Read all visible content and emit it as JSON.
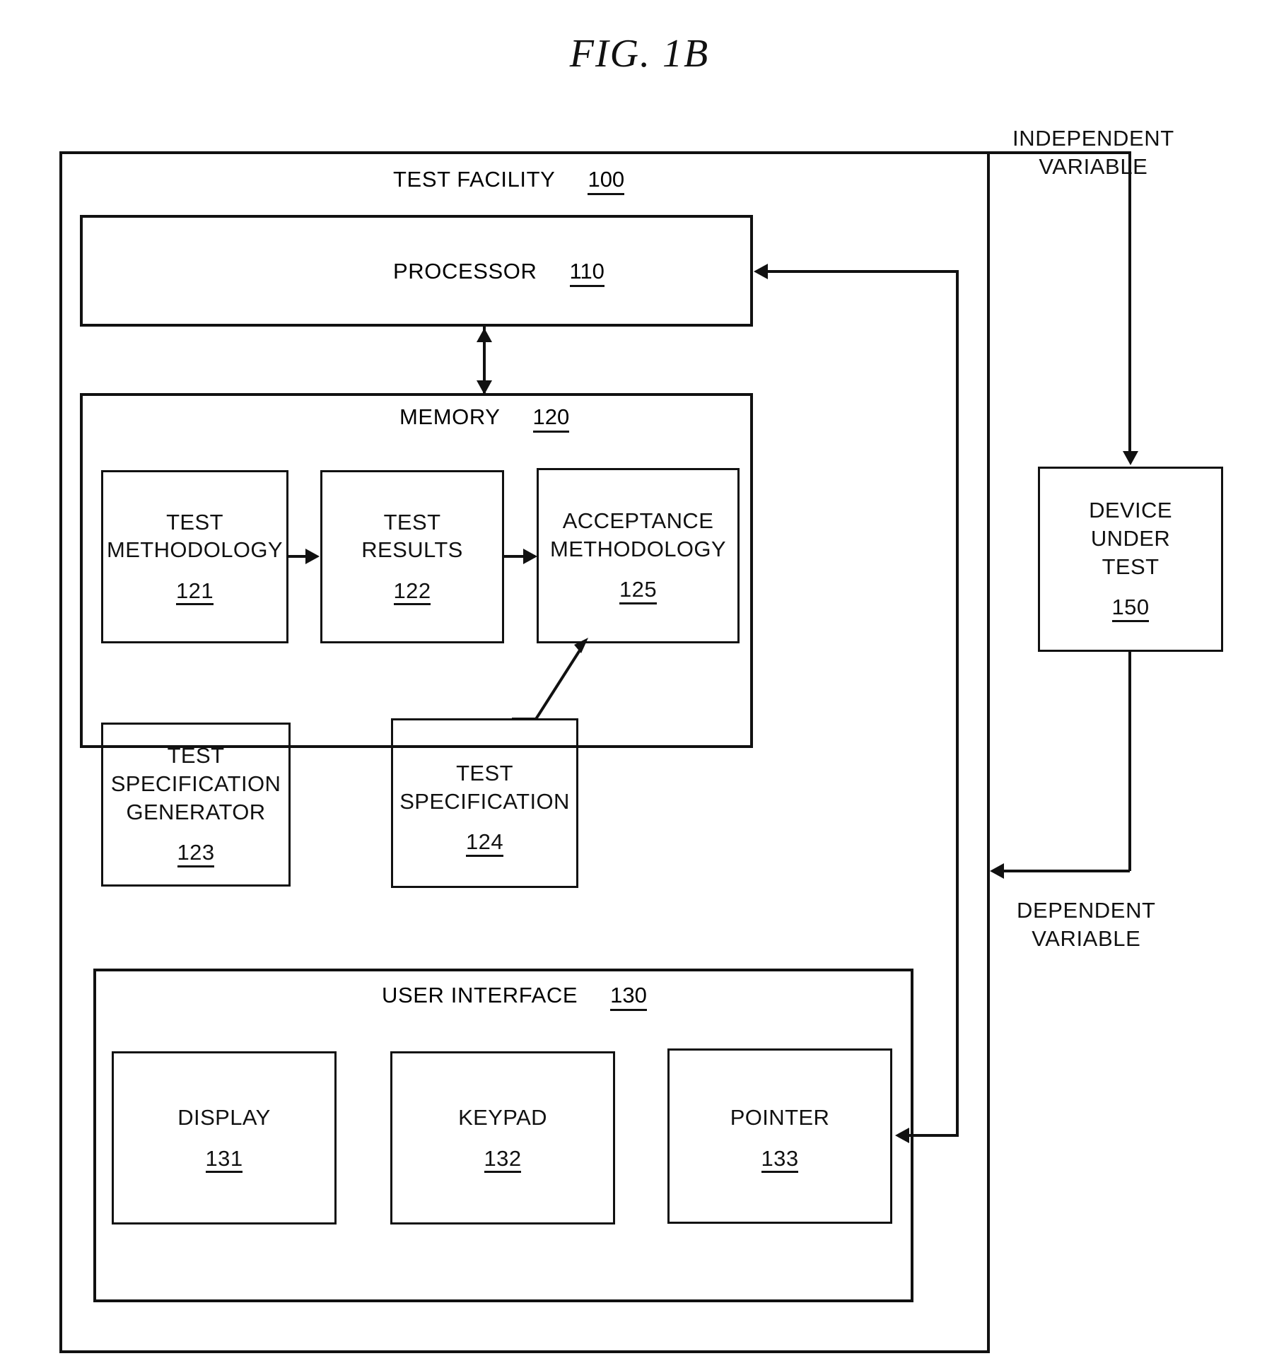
{
  "figure": {
    "title": "FIG. 1B"
  },
  "test_facility": {
    "label": "TEST FACILITY",
    "ref": "100"
  },
  "processor": {
    "label": "PROCESSOR",
    "ref": "110"
  },
  "memory": {
    "label": "MEMORY",
    "ref": "120",
    "blocks": [
      {
        "name": "test-methodology",
        "line1": "TEST",
        "line2": "METHODOLOGY",
        "line3": "",
        "ref": "121"
      },
      {
        "name": "test-results",
        "line1": "TEST",
        "line2": "RESULTS",
        "line3": "",
        "ref": "122"
      },
      {
        "name": "acceptance-methodology",
        "line1": "ACCEPTANCE",
        "line2": "METHODOLOGY",
        "line3": "",
        "ref": "125"
      },
      {
        "name": "test-specification-generator",
        "line1": "TEST",
        "line2": "SPECIFICATION",
        "line3": "GENERATOR",
        "ref": "123"
      },
      {
        "name": "test-specification",
        "line1": "TEST",
        "line2": "SPECIFICATION",
        "line3": "",
        "ref": "124"
      }
    ]
  },
  "user_interface": {
    "label": "USER INTERFACE",
    "ref": "130",
    "blocks": [
      {
        "name": "display",
        "label": "DISPLAY",
        "ref": "131"
      },
      {
        "name": "keypad",
        "label": "KEYPAD",
        "ref": "132"
      },
      {
        "name": "pointer",
        "label": "POINTER",
        "ref": "133"
      }
    ]
  },
  "device_under_test": {
    "line1": "DEVICE",
    "line2": "UNDER",
    "line3": "TEST",
    "ref": "150"
  },
  "annotations": {
    "independent_variable_l1": "INDEPENDENT",
    "independent_variable_l2": "VARIABLE",
    "dependent_variable_l1": "DEPENDENT",
    "dependent_variable_l2": "VARIABLE"
  },
  "colors": {
    "ink": "#111111",
    "paper": "#ffffff"
  }
}
